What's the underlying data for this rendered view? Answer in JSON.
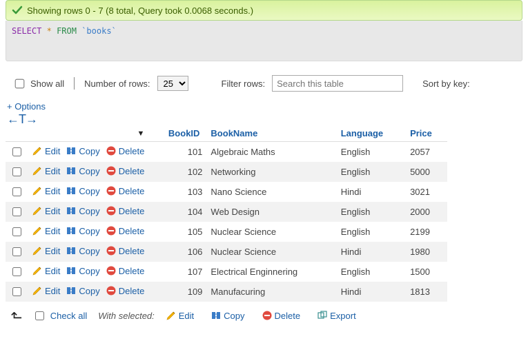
{
  "success": {
    "text": "Showing rows 0 - 7 (8 total, Query took 0.0068 seconds.)"
  },
  "sql": {
    "select": "SELECT",
    "star": "*",
    "from": "FROM",
    "table": "`books`"
  },
  "toolbar": {
    "show_all": "Show all",
    "num_rows_label": "Number of rows:",
    "num_rows_value": "25",
    "filter_label": "Filter rows:",
    "filter_placeholder": "Search this table",
    "sort_label": "Sort by key:"
  },
  "options_link": "+ Options",
  "arrows": "←T→",
  "columns": {
    "c1": "BookID",
    "c2": "BookName",
    "c3": "Language",
    "c4": "Price"
  },
  "actions": {
    "edit": "Edit",
    "copy": "Copy",
    "delete": "Delete"
  },
  "rows": [
    {
      "id": "101",
      "name": "Algebraic Maths",
      "lang": "English",
      "price": "2057"
    },
    {
      "id": "102",
      "name": "Networking",
      "lang": "English",
      "price": "5000"
    },
    {
      "id": "103",
      "name": "Nano Science",
      "lang": "Hindi",
      "price": "3021"
    },
    {
      "id": "104",
      "name": "Web Design",
      "lang": "English",
      "price": "2000"
    },
    {
      "id": "105",
      "name": "Nuclear Science",
      "lang": "English",
      "price": "2199"
    },
    {
      "id": "106",
      "name": "Nuclear Science",
      "lang": "Hindi",
      "price": "1980"
    },
    {
      "id": "107",
      "name": "Electrical Enginnering",
      "lang": "English",
      "price": "1500"
    },
    {
      "id": "109",
      "name": "Manufacuring",
      "lang": "Hindi",
      "price": "1813"
    }
  ],
  "footer": {
    "check_all": "Check all",
    "with_selected": "With selected:",
    "edit": "Edit",
    "copy": "Copy",
    "delete": "Delete",
    "export": "Export"
  }
}
